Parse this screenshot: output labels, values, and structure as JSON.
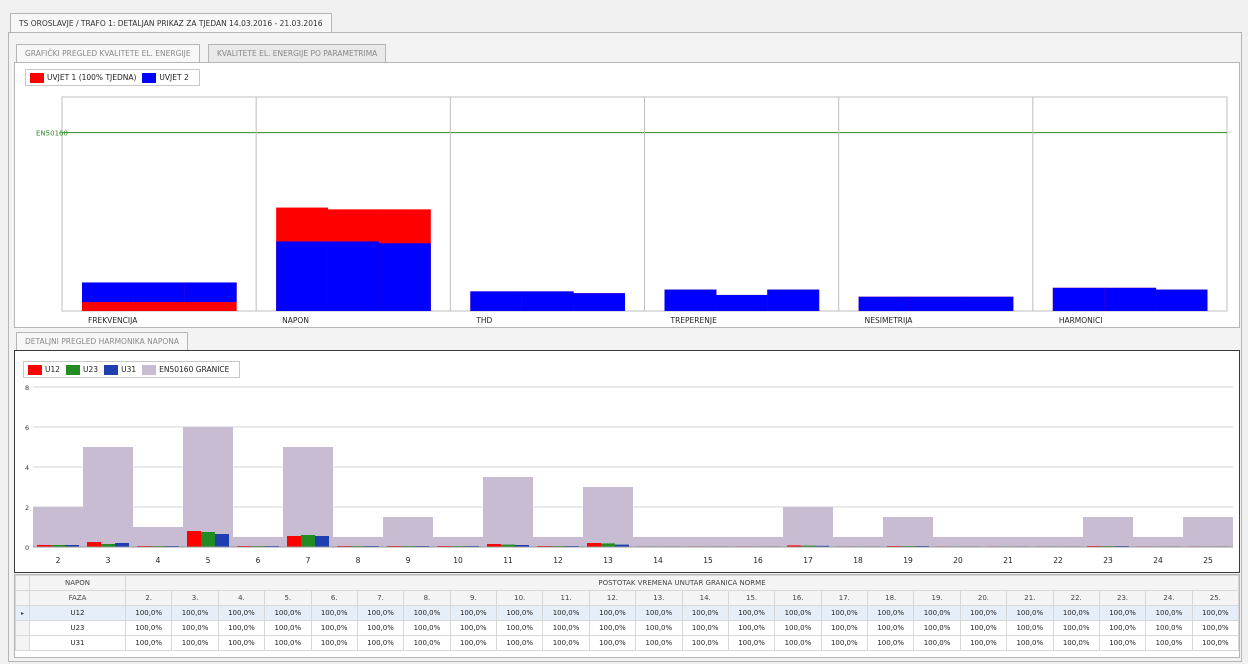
{
  "window": {
    "title_tab": "TS OROSLAVJE / TRAFO 1: DETALJAN PRIKAZ ZA TJEDAN 14.03.2016 - 21.03.2016"
  },
  "tabs": {
    "graphic": "GRAFIČKI PREGLED KVALITETE EL. ENERGIJE",
    "params": "KVALITETE EL. ENERGIJE PO PARAMETRIMA",
    "harmonics": "DETALJNI PREGLED HARMONIKA NAPONA"
  },
  "colors": {
    "red": "#ff0000",
    "blue": "#0000ff",
    "green": "#228b22",
    "darkblue": "#1f3fb0",
    "lavender": "#c8bcd3",
    "en_line": "#2e8b2e"
  },
  "top_legend": {
    "cond1": "UVJET 1 (100% TJEDNA)",
    "cond2": "UVJET 2"
  },
  "chart_data": [
    {
      "type": "bar",
      "reference_line": {
        "label": "EN50160",
        "value": 1.0
      },
      "categories": [
        "FREKVENCIJA",
        "NAPON",
        "THD",
        "TREPERENJE",
        "NESIMETRIJA",
        "HARMONICI"
      ],
      "sub_bars_per_category": 3,
      "series": [
        {
          "name": "UVJET 1 (100% TJEDNA)",
          "color": "#ff0000",
          "values": [
            [
              0.05,
              0.05,
              0.05
            ],
            [
              0.58,
              0.57,
              0.57
            ],
            [
              0.11,
              0.11,
              0.1
            ],
            [
              0.12,
              0.09,
              0.12
            ],
            [
              0.08,
              0.08,
              0.08
            ],
            [
              0.13,
              0.13,
              0.12
            ]
          ]
        },
        {
          "name": "UVJET 2",
          "color": "#0000ff",
          "values": [
            [
              0.16,
              0.16,
              0.16
            ],
            [
              0.39,
              0.39,
              0.38
            ],
            [
              0.11,
              0.11,
              0.1
            ],
            [
              0.12,
              0.09,
              0.12
            ],
            [
              0.08,
              0.08,
              0.08
            ],
            [
              0.13,
              0.13,
              0.12
            ]
          ]
        }
      ],
      "ylim": [
        0,
        1.2
      ]
    },
    {
      "type": "bar",
      "categories": [
        "2",
        "3",
        "4",
        "5",
        "6",
        "7",
        "8",
        "9",
        "10",
        "11",
        "12",
        "13",
        "14",
        "15",
        "16",
        "17",
        "18",
        "19",
        "20",
        "21",
        "22",
        "23",
        "24",
        "25"
      ],
      "yticks": [
        "0",
        "2",
        "4",
        "6",
        "8"
      ],
      "ylim": [
        0,
        8
      ],
      "grid": true,
      "legend": [
        {
          "name": "U12",
          "color": "#ff0000"
        },
        {
          "name": "U23",
          "color": "#228b22"
        },
        {
          "name": "U31",
          "color": "#1f3fb0"
        },
        {
          "name": "EN50160 GRANICE",
          "color": "#c8bcd3"
        }
      ],
      "limits": [
        2,
        5,
        1,
        6,
        0.5,
        5,
        0.5,
        1.5,
        0.5,
        3.5,
        0.5,
        3,
        0.5,
        0.5,
        0.5,
        2,
        0.5,
        1.5,
        0.5,
        0.5,
        0.5,
        1.5,
        0.5,
        1.5
      ],
      "series": [
        {
          "name": "U12",
          "values": [
            0.1,
            0.25,
            0.05,
            0.8,
            0.05,
            0.55,
            0.05,
            0.05,
            0.05,
            0.15,
            0.05,
            0.2,
            0.03,
            0.03,
            0.03,
            0.08,
            0.03,
            0.05,
            0.03,
            0.03,
            0.03,
            0.05,
            0.03,
            0.03
          ]
        },
        {
          "name": "U23",
          "values": [
            0.1,
            0.15,
            0.05,
            0.75,
            0.05,
            0.6,
            0.05,
            0.05,
            0.05,
            0.12,
            0.05,
            0.18,
            0.03,
            0.03,
            0.03,
            0.07,
            0.03,
            0.05,
            0.03,
            0.03,
            0.03,
            0.05,
            0.03,
            0.03
          ]
        },
        {
          "name": "U31",
          "values": [
            0.1,
            0.2,
            0.05,
            0.65,
            0.05,
            0.55,
            0.05,
            0.05,
            0.05,
            0.1,
            0.05,
            0.12,
            0.03,
            0.03,
            0.03,
            0.06,
            0.03,
            0.05,
            0.03,
            0.03,
            0.03,
            0.05,
            0.03,
            0.03
          ]
        }
      ]
    }
  ],
  "table": {
    "napon_label": "NAPON",
    "faza_label": "FAZA",
    "header_title": "POSTOTAK VREMENA UNUTAR GRANICA NORME",
    "harmonic_cols": [
      "2.",
      "3.",
      "4.",
      "5.",
      "6.",
      "7.",
      "8.",
      "9.",
      "10.",
      "11.",
      "12.",
      "13.",
      "14.",
      "15.",
      "16.",
      "17.",
      "18.",
      "19.",
      "20.",
      "21.",
      "22.",
      "23.",
      "24.",
      "25."
    ],
    "rows": [
      {
        "phase": "U12",
        "values": [
          "100,0%",
          "100,0%",
          "100,0%",
          "100,0%",
          "100,0%",
          "100,0%",
          "100,0%",
          "100,0%",
          "100,0%",
          "100,0%",
          "100,0%",
          "100,0%",
          "100,0%",
          "100,0%",
          "100,0%",
          "100,0%",
          "100,0%",
          "100,0%",
          "100,0%",
          "100,0%",
          "100,0%",
          "100,0%",
          "100,0%",
          "100,0%"
        ]
      },
      {
        "phase": "U23",
        "values": [
          "100,0%",
          "100,0%",
          "100,0%",
          "100,0%",
          "100,0%",
          "100,0%",
          "100,0%",
          "100,0%",
          "100,0%",
          "100,0%",
          "100,0%",
          "100,0%",
          "100,0%",
          "100,0%",
          "100,0%",
          "100,0%",
          "100,0%",
          "100,0%",
          "100,0%",
          "100,0%",
          "100,0%",
          "100,0%",
          "100,0%",
          "100,0%"
        ]
      },
      {
        "phase": "U31",
        "values": [
          "100,0%",
          "100,0%",
          "100,0%",
          "100,0%",
          "100,0%",
          "100,0%",
          "100,0%",
          "100,0%",
          "100,0%",
          "100,0%",
          "100,0%",
          "100,0%",
          "100,0%",
          "100,0%",
          "100,0%",
          "100,0%",
          "100,0%",
          "100,0%",
          "100,0%",
          "100,0%",
          "100,0%",
          "100,0%",
          "100,0%",
          "100,0%"
        ]
      }
    ]
  }
}
